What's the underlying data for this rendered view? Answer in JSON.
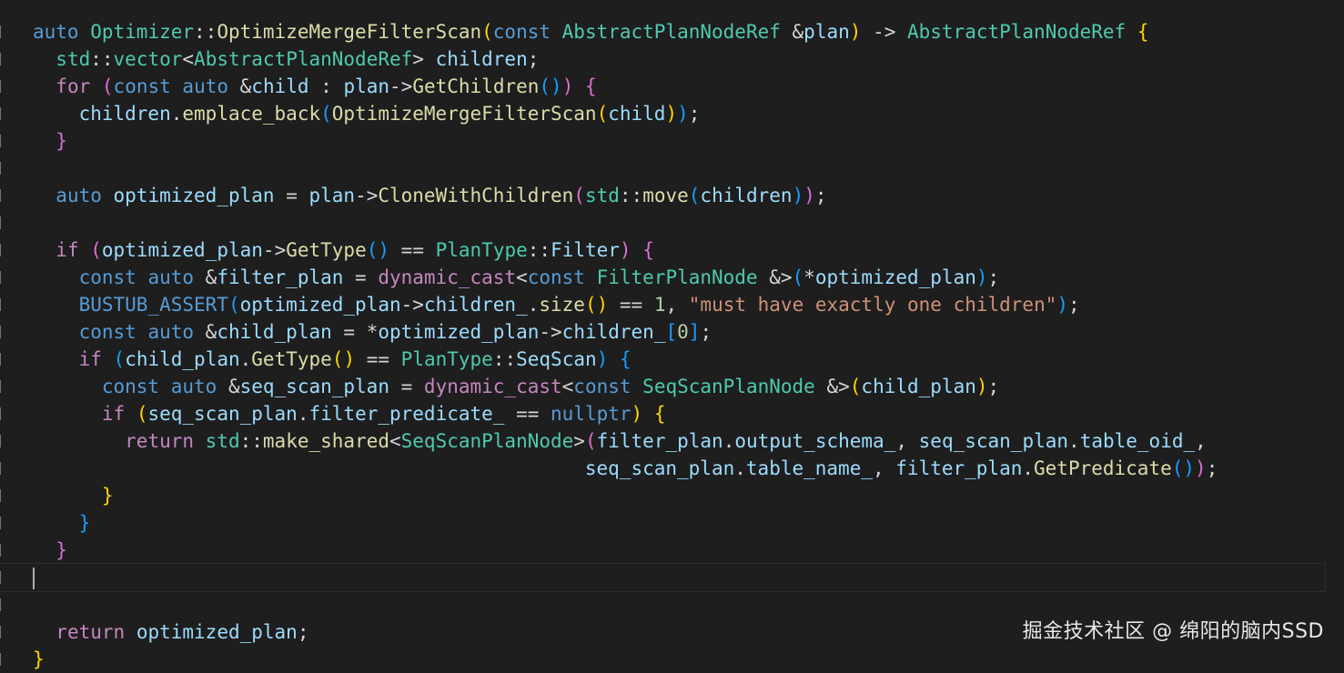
{
  "colors": {
    "background": "#1e1e1e",
    "keyword": "#569cd6",
    "control": "#c586c0",
    "type": "#4ec9b0",
    "function": "#dcdcaa",
    "variable": "#9cdcfe",
    "text": "#d4d4d4",
    "string": "#ce9178",
    "number": "#b5cea8",
    "bracket1": "#ffd700",
    "bracket2": "#da70d6",
    "bracket3": "#179fff"
  },
  "watermark": "掘金技术社区 @ 绵阳的脑内SSD",
  "lines": [
    [
      [
        "auto",
        "k"
      ],
      [
        " ",
        "t"
      ],
      [
        "Optimizer",
        "y"
      ],
      [
        "::",
        "t"
      ],
      [
        "OptimizeMergeFilterScan",
        "f"
      ],
      [
        "(",
        "b1"
      ],
      [
        "const",
        "k"
      ],
      [
        " ",
        "t"
      ],
      [
        "AbstractPlanNodeRef",
        "y"
      ],
      [
        " &",
        "t"
      ],
      [
        "plan",
        "v"
      ],
      [
        ")",
        "b1"
      ],
      [
        " -> ",
        "t"
      ],
      [
        "AbstractPlanNodeRef",
        "y"
      ],
      [
        " ",
        "t"
      ],
      [
        "{",
        "b1"
      ]
    ],
    [
      [
        "  ",
        "t"
      ],
      [
        "std",
        "y"
      ],
      [
        "::",
        "t"
      ],
      [
        "vector",
        "y"
      ],
      [
        "<",
        "t"
      ],
      [
        "AbstractPlanNodeRef",
        "y"
      ],
      [
        "> ",
        "t"
      ],
      [
        "children",
        "v"
      ],
      [
        ";",
        "t"
      ]
    ],
    [
      [
        "  ",
        "t"
      ],
      [
        "for",
        "c"
      ],
      [
        " ",
        "t"
      ],
      [
        "(",
        "b2"
      ],
      [
        "const",
        "k"
      ],
      [
        " ",
        "t"
      ],
      [
        "auto",
        "k"
      ],
      [
        " &",
        "t"
      ],
      [
        "child",
        "v"
      ],
      [
        " : ",
        "t"
      ],
      [
        "plan",
        "v"
      ],
      [
        "->",
        "t"
      ],
      [
        "GetChildren",
        "f"
      ],
      [
        "()",
        "b3"
      ],
      [
        ")",
        "b2"
      ],
      [
        " ",
        "t"
      ],
      [
        "{",
        "b2"
      ]
    ],
    [
      [
        "    ",
        "t"
      ],
      [
        "children",
        "v"
      ],
      [
        ".",
        "t"
      ],
      [
        "emplace_back",
        "f"
      ],
      [
        "(",
        "b3"
      ],
      [
        "OptimizeMergeFilterScan",
        "f"
      ],
      [
        "(",
        "b1"
      ],
      [
        "child",
        "v"
      ],
      [
        ")",
        "b1"
      ],
      [
        ")",
        "b3"
      ],
      [
        ";",
        "t"
      ]
    ],
    [
      [
        "  ",
        "t"
      ],
      [
        "}",
        "b2"
      ]
    ],
    [
      [
        "",
        "t"
      ]
    ],
    [
      [
        "  ",
        "t"
      ],
      [
        "auto",
        "k"
      ],
      [
        " ",
        "t"
      ],
      [
        "optimized_plan",
        "v"
      ],
      [
        " = ",
        "t"
      ],
      [
        "plan",
        "v"
      ],
      [
        "->",
        "t"
      ],
      [
        "CloneWithChildren",
        "f"
      ],
      [
        "(",
        "b2"
      ],
      [
        "std",
        "y"
      ],
      [
        "::",
        "t"
      ],
      [
        "move",
        "f"
      ],
      [
        "(",
        "b3"
      ],
      [
        "children",
        "v"
      ],
      [
        ")",
        "b3"
      ],
      [
        ")",
        "b2"
      ],
      [
        ";",
        "t"
      ]
    ],
    [
      [
        "",
        "t"
      ]
    ],
    [
      [
        "  ",
        "t"
      ],
      [
        "if",
        "c"
      ],
      [
        " ",
        "t"
      ],
      [
        "(",
        "b2"
      ],
      [
        "optimized_plan",
        "v"
      ],
      [
        "->",
        "t"
      ],
      [
        "GetType",
        "f"
      ],
      [
        "()",
        "b3"
      ],
      [
        " == ",
        "t"
      ],
      [
        "PlanType",
        "y"
      ],
      [
        "::",
        "t"
      ],
      [
        "Filter",
        "v"
      ],
      [
        ")",
        "b2"
      ],
      [
        " ",
        "t"
      ],
      [
        "{",
        "b2"
      ]
    ],
    [
      [
        "    ",
        "t"
      ],
      [
        "const",
        "k"
      ],
      [
        " ",
        "t"
      ],
      [
        "auto",
        "k"
      ],
      [
        " &",
        "t"
      ],
      [
        "filter_plan",
        "v"
      ],
      [
        " = ",
        "t"
      ],
      [
        "dynamic_cast",
        "c"
      ],
      [
        "<",
        "t"
      ],
      [
        "const",
        "k"
      ],
      [
        " ",
        "t"
      ],
      [
        "FilterPlanNode",
        "y"
      ],
      [
        " &>",
        "t"
      ],
      [
        "(",
        "b3"
      ],
      [
        "*",
        "t"
      ],
      [
        "optimized_plan",
        "v"
      ],
      [
        ")",
        "b3"
      ],
      [
        ";",
        "t"
      ]
    ],
    [
      [
        "    ",
        "t"
      ],
      [
        "BUSTUB_ASSERT",
        "k"
      ],
      [
        "(",
        "b3"
      ],
      [
        "optimized_plan",
        "v"
      ],
      [
        "->",
        "t"
      ],
      [
        "children_",
        "v"
      ],
      [
        ".",
        "t"
      ],
      [
        "size",
        "f"
      ],
      [
        "()",
        "b1"
      ],
      [
        " == ",
        "t"
      ],
      [
        "1",
        "n"
      ],
      [
        ", ",
        "t"
      ],
      [
        "\"must have exactly one children\"",
        "s"
      ],
      [
        ")",
        "b3"
      ],
      [
        ";",
        "t"
      ]
    ],
    [
      [
        "    ",
        "t"
      ],
      [
        "const",
        "k"
      ],
      [
        " ",
        "t"
      ],
      [
        "auto",
        "k"
      ],
      [
        " &",
        "t"
      ],
      [
        "child_plan",
        "v"
      ],
      [
        " = ",
        "t"
      ],
      [
        "*",
        "t"
      ],
      [
        "optimized_plan",
        "v"
      ],
      [
        "->",
        "t"
      ],
      [
        "children_",
        "v"
      ],
      [
        "[",
        "b3"
      ],
      [
        "0",
        "n"
      ],
      [
        "]",
        "b3"
      ],
      [
        ";",
        "t"
      ]
    ],
    [
      [
        "    ",
        "t"
      ],
      [
        "if",
        "c"
      ],
      [
        " ",
        "t"
      ],
      [
        "(",
        "b3"
      ],
      [
        "child_plan",
        "v"
      ],
      [
        ".",
        "t"
      ],
      [
        "GetType",
        "f"
      ],
      [
        "()",
        "b1"
      ],
      [
        " == ",
        "t"
      ],
      [
        "PlanType",
        "y"
      ],
      [
        "::",
        "t"
      ],
      [
        "SeqScan",
        "v"
      ],
      [
        ")",
        "b3"
      ],
      [
        " ",
        "t"
      ],
      [
        "{",
        "b3"
      ]
    ],
    [
      [
        "      ",
        "t"
      ],
      [
        "const",
        "k"
      ],
      [
        " ",
        "t"
      ],
      [
        "auto",
        "k"
      ],
      [
        " &",
        "t"
      ],
      [
        "seq_scan_plan",
        "v"
      ],
      [
        " = ",
        "t"
      ],
      [
        "dynamic_cast",
        "c"
      ],
      [
        "<",
        "t"
      ],
      [
        "const",
        "k"
      ],
      [
        " ",
        "t"
      ],
      [
        "SeqScanPlanNode",
        "y"
      ],
      [
        " &>",
        "t"
      ],
      [
        "(",
        "b1"
      ],
      [
        "child_plan",
        "v"
      ],
      [
        ")",
        "b1"
      ],
      [
        ";",
        "t"
      ]
    ],
    [
      [
        "      ",
        "t"
      ],
      [
        "if",
        "c"
      ],
      [
        " ",
        "t"
      ],
      [
        "(",
        "b1"
      ],
      [
        "seq_scan_plan",
        "v"
      ],
      [
        ".",
        "t"
      ],
      [
        "filter_predicate_",
        "v"
      ],
      [
        " == ",
        "t"
      ],
      [
        "nullptr",
        "k"
      ],
      [
        ")",
        "b1"
      ],
      [
        " ",
        "t"
      ],
      [
        "{",
        "b1"
      ]
    ],
    [
      [
        "        ",
        "t"
      ],
      [
        "return",
        "c"
      ],
      [
        " ",
        "t"
      ],
      [
        "std",
        "y"
      ],
      [
        "::",
        "t"
      ],
      [
        "make_shared",
        "f"
      ],
      [
        "<",
        "t"
      ],
      [
        "SeqScanPlanNode",
        "y"
      ],
      [
        ">",
        "t"
      ],
      [
        "(",
        "b2"
      ],
      [
        "filter_plan",
        "v"
      ],
      [
        ".",
        "t"
      ],
      [
        "output_schema_",
        "v"
      ],
      [
        ", ",
        "t"
      ],
      [
        "seq_scan_plan",
        "v"
      ],
      [
        ".",
        "t"
      ],
      [
        "table_oid_",
        "v"
      ],
      [
        ",",
        "t"
      ]
    ],
    [
      [
        "                                                ",
        "t"
      ],
      [
        "seq_scan_plan",
        "v"
      ],
      [
        ".",
        "t"
      ],
      [
        "table_name_",
        "v"
      ],
      [
        ", ",
        "t"
      ],
      [
        "filter_plan",
        "v"
      ],
      [
        ".",
        "t"
      ],
      [
        "GetPredicate",
        "f"
      ],
      [
        "()",
        "b3"
      ],
      [
        ")",
        "b2"
      ],
      [
        ";",
        "t"
      ]
    ],
    [
      [
        "      ",
        "t"
      ],
      [
        "}",
        "b1"
      ]
    ],
    [
      [
        "    ",
        "t"
      ],
      [
        "}",
        "b3"
      ]
    ],
    [
      [
        "  ",
        "t"
      ],
      [
        "}",
        "b2"
      ]
    ],
    [
      [
        "",
        "t"
      ]
    ],
    [
      [
        "",
        "t"
      ]
    ],
    [
      [
        "  ",
        "t"
      ],
      [
        "return",
        "c"
      ],
      [
        " ",
        "t"
      ],
      [
        "optimized_plan",
        "v"
      ],
      [
        ";",
        "t"
      ]
    ],
    [
      [
        "}",
        "b1"
      ]
    ]
  ]
}
